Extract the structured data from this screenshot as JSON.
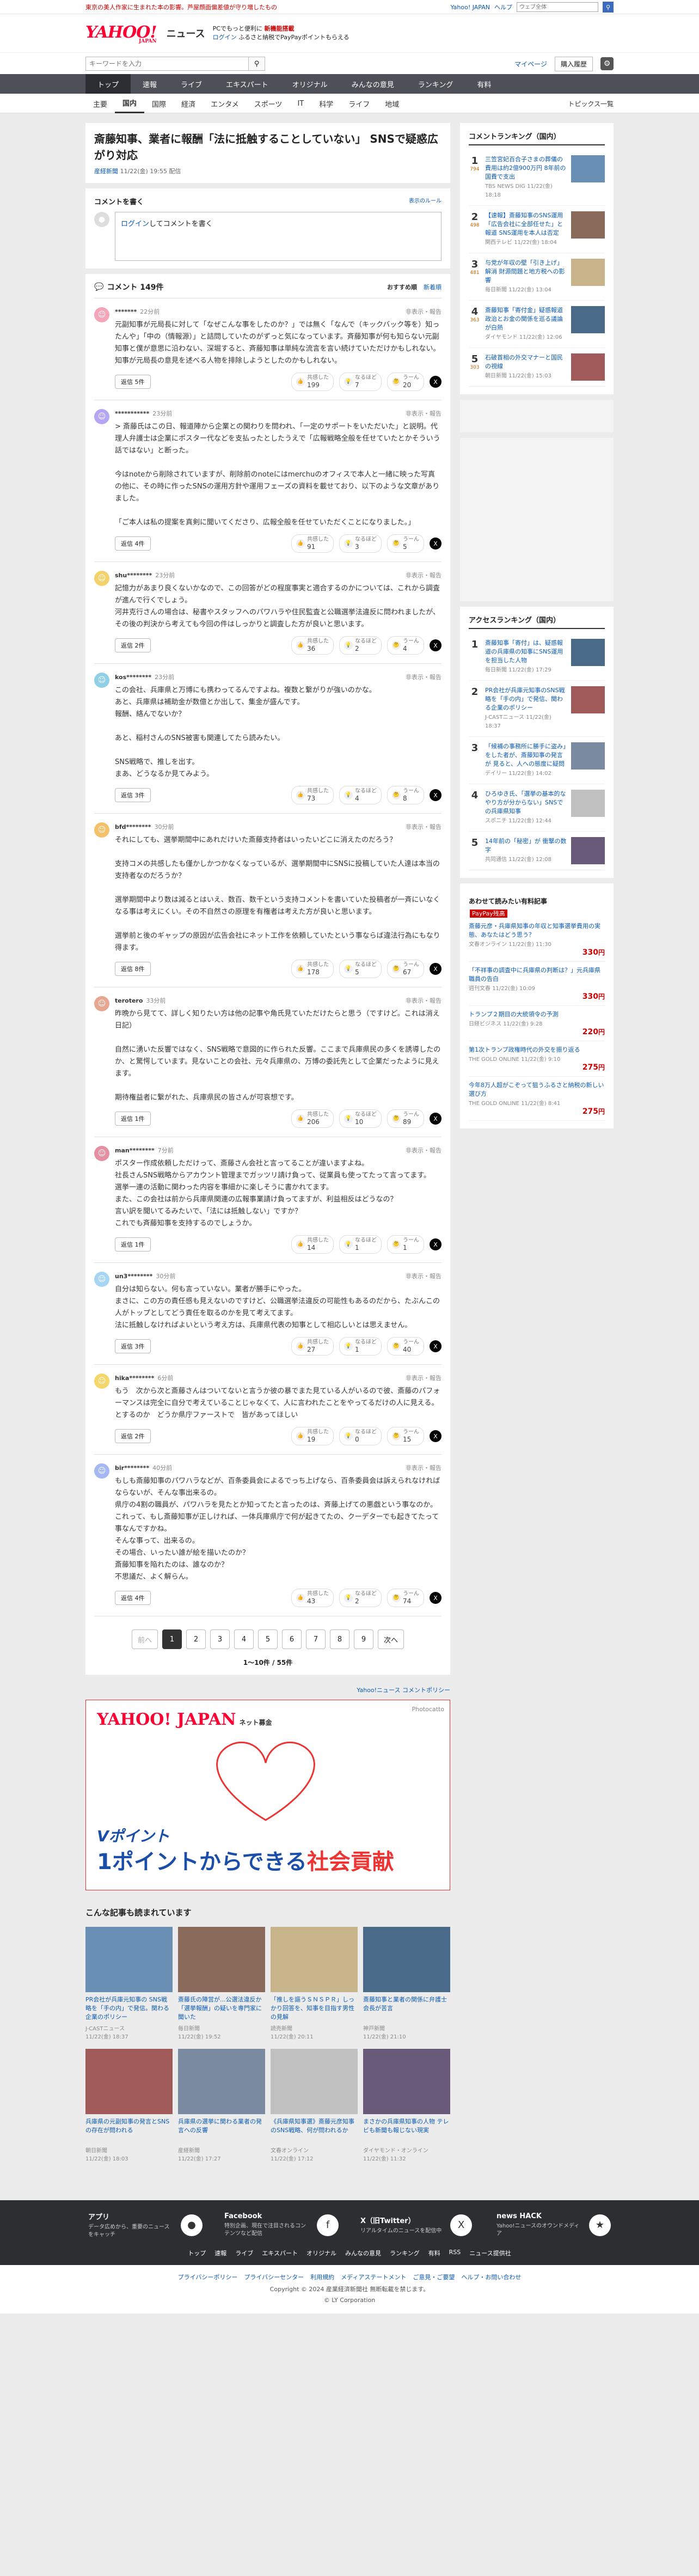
{
  "top_strip": {
    "notice": "東京の美人作家に生まれた本の影響。芦屋顔面偏差値が守り増したもの",
    "links": [
      "Yahoo! JAPAN",
      "ヘルプ"
    ],
    "search_placeholder": "ウェブ全体"
  },
  "header": {
    "logo": "YAHOO!",
    "logo_sub": "JAPAN",
    "service": "ニュース",
    "promo_line1_a": "PCでもっと便利に",
    "promo_line1_b": "新機能搭載",
    "promo_line2_a": "ログイン",
    "promo_line2_b": "ふるさと納税でPayPayポイントもらえる"
  },
  "search": {
    "placeholder": "キーワードを入力",
    "mypage": "マイページ",
    "register": "購入履歴"
  },
  "main_nav": [
    "トップ",
    "速報",
    "ライブ",
    "エキスパート",
    "オリジナル",
    "みんなの意見",
    "ランキング",
    "有料"
  ],
  "sub_nav": {
    "cats": [
      "主要",
      "国内",
      "国際",
      "経済",
      "エンタメ",
      "スポーツ",
      "IT",
      "科学",
      "ライフ",
      "地域"
    ],
    "topics": "トピックス一覧"
  },
  "article": {
    "title": "斎藤知事、業者に報酬「法に抵触することしていない」 SNSで疑惑広がり対応",
    "source": "産経新聞",
    "date": "11/22(金) 19:55 配信"
  },
  "comment_write": {
    "heading": "コメントを書く",
    "policy": "表示のルール",
    "login": "ログイン",
    "placeholder": "してコメントを書く"
  },
  "comments_head": {
    "count": "コメント 149件",
    "sort_recommended": "おすすめ順",
    "sort_new": "新着順"
  },
  "vote_labels": {
    "a": "共感した",
    "b": "なるほど",
    "c": "うーん"
  },
  "common": {
    "reply": "返信",
    "report": "非表示・報告"
  },
  "comments": [
    {
      "user": "*******",
      "time": "22分前",
      "text": "元副知事が元局長に対して「なぜこんな事をしたのか？」では無く「なんで（キックバック等を）知ったんや」「中の（情報源）」と詰問していたのがずっと気になっています。斉藤知事が何も知らない元副知事と僕が意思に沿わない、深堀すると、斉藤知事は単純な流言を言い続けていただけかもしれない。\n知事が元局長の意見を述べる人物を排除しようとしたのかもしれない。",
      "replies": "返信 5件",
      "v1": "199",
      "v2": "7",
      "v3": "20"
    },
    {
      "user": "***********",
      "time": "23分前",
      "text": "> 斎藤氏はこの日、報道陣から企業との関わりを問われ、「一定のサポートをいただいた」と説明。代理人弁護士は企業にポスター代などを支払ったとしたうえで「広報戦略全般を任せていたとかそういう話ではない」と断った。\n\n今はnoteから削除されていますが、削除前のnoteにはmerchuのオフィスで本人と一緒に映った写真の他に、その時に作ったSNSの運用方針や運用フェーズの資料を載せており、以下のような文章がありました。\n\n「ご本人は私の提案を真剣に聞いてくださり、広報全般を任せていただくことになりました。」",
      "replies": "返信 4件",
      "v1": "91",
      "v2": "3",
      "v3": "5"
    },
    {
      "user": "shu********",
      "time": "23分前",
      "text": "記憶力があまり良くないかなので、この回答がどの程度事実と適合するのかについては、これから調査が進んで行くでしょう。\n河井克行さんの場合は、秘書やスタッフへのパワハラや住民監査と公職選挙法違反に問われましたが、その後の判決から考えても今回の件はしっかりと調査した方が良いと思います。",
      "replies": "返信 2件",
      "v1": "36",
      "v2": "2",
      "v3": "4"
    },
    {
      "user": "kos********",
      "time": "23分前",
      "text": "この会社、兵庫県と万博にも携わってるんですよね。複数と繋がりが強いのかな。\nあと、兵庫県は補助金が数億とか出して、集金が盛んです。\n報酬、絡んでないか？\n\nあと、稲村さんのSNS被害も関連してたら読みたい。\n\nSNS戦略で、推しを出す。\nまあ、どうなるか見てみよう。",
      "replies": "返信 3件",
      "v1": "73",
      "v2": "4",
      "v3": "8"
    },
    {
      "user": "bfd********",
      "time": "30分前",
      "text": "それにしても、選挙期間中にあれだけいた斎藤支持者はいったいどこに消えたのだろう？\n\n支持コメの共感したも僅かしかつかなくなっているが、選挙期間中にSNSに投稿していた人達は本当の支持者なのだろうか？\n\n選挙期間中より数は減るとはいえ、数百、数千という支持コメントを書いていた投稿者が一斉にいなくなる事は考えにくい。その不自然さの原理を有権者は考えた方が良いと思います。\n\n選挙前と後のギャップの原因が広告会社にネット工作を依頼していたという事ならば違法行為にもなり得ます。",
      "replies": "返信 8件",
      "v1": "178",
      "v2": "5",
      "v3": "67"
    },
    {
      "user": "terotero",
      "time": "33分前",
      "text": "昨晩から見てて、詳しく知りたい方は他の記事や角氏見ていただけたらと思う（ですけど。これは消え日記）\n\n自然に湧いた反響ではなく、SNS戦略で意図的に作られた反響。ここまで兵庫県民の多くを誘導したのか、と驚愕しています。見ないことの会社、元々兵庫県の、万博の委託先として企業だったように見えます。\n\n期待権益者に繋がれた、兵庫県民の皆さんが可哀想です。",
      "replies": "返信 1件",
      "v1": "206",
      "v2": "10",
      "v3": "89"
    },
    {
      "user": "man********",
      "time": "7分前",
      "text": "ポスター作成依頼しただけって、斎藤さん会社と言ってることが違いますよね。\n社長さんSNS戦略からアカウント管理までガッツリ請け負って、従業員も使ってたって言ってます。\n選挙一連の活動に関わった内容を事細かに楽しそうに書かれてます。\nまた、この会社は前から兵庫県関連の広報事業請け負ってますが、利益相反はどうなの？\n言い訳を聞いてるみたいで、「法には抵触しない」ですか？\nこれでも斉藤知事を支持するのでしょうか。",
      "replies": "返信 1件",
      "v1": "14",
      "v2": "1",
      "v3": "1"
    },
    {
      "user": "un3********",
      "time": "30分前",
      "text": "自分は知らない。何も言っていない。業者が勝手にやった。\nまさに、この方の責任感も見えないのですけど、公職選挙法違反の可能性もあるのだから、たぶんこの人がトップとしてどう責任を取るのかを見て考えてます。\n法に抵触しなければよいという考え方は、兵庫県代表の知事として相応しいとは思えません。",
      "replies": "返信 3件",
      "v1": "27",
      "v2": "1",
      "v3": "40"
    },
    {
      "user": "hika********",
      "time": "6分前",
      "text": "もう　次から次と斎藤さんはついてないと言うか彼の暴でまた見ている人がいるので彼、斎藤のパフォーマンスは完全に自分で考えていることじゃなくて、人に言われたことをやってるだけの人に見える。\nとするのか　どうか県庁ファーストで　皆があってほしい",
      "replies": "返信 2件",
      "v1": "19",
      "v2": "0",
      "v3": "15"
    },
    {
      "user": "bir********",
      "time": "40分前",
      "text": "もしも斎藤知事のパワハラなどが、百条委員会によるでっち上げなら、百条委員会は訴えられなければならないが、そんな事出来るの。\n県庁の4割の職員が、パワハラを見たとか知ってたと言ったのは、斉藤上げての悪戯という事なのか。\nこれって、もし斎藤知事が正しければ、一体兵庫県庁で何が起きてたの、クーデターでも起きてたって事なんですかね。\nそんな事って、出来るの。\nその場合、いったい誰が絵を描いたのか？\n斎藤知事を陥れたのは、誰なのか？\n不思議だ、よく解らん。",
      "replies": "返信 4件",
      "v1": "43",
      "v2": "2",
      "v3": "74"
    }
  ],
  "pager": {
    "prev": "前へ",
    "pages": [
      "1",
      "2",
      "3",
      "4",
      "5",
      "6",
      "7",
      "8",
      "9"
    ],
    "next": "次へ",
    "info": "1〜10件 / 55件"
  },
  "guideline": "Yahoo!ニュース コメントポリシー",
  "ad": {
    "logo": "YAHOO! JAPAN",
    "logo_sub": "ネット募金",
    "photo": "Photocatto",
    "line1": "Vポイント",
    "line2a": "1ポイントからできる",
    "line2b": "社会貢献"
  },
  "recs": {
    "title": "こんな記事も読まれています",
    "items": [
      {
        "title": "PR会社が兵庫元知事の SNS戦略を「手の内」で発信。関わる企業のポリシー",
        "src": "J-CASTニュース",
        "time": "11/22(金) 18:37"
      },
      {
        "title": "斎藤氏の陣営が...公選法違反か「選挙報酬」の疑いを専門家に聞いた",
        "src": "毎日新聞",
        "time": "11/22(金) 19:52"
      },
      {
        "title": "「推しを謳うＳＮＳＰＲ」しっかり回答を、知事を目指す男性の見解",
        "src": "読売新聞",
        "time": "11/22(金) 20:11"
      },
      {
        "title": "斎藤知事と業者の関係に弁護士会長が苦言",
        "src": "神戸新聞",
        "time": "11/22(金) 21:10"
      },
      {
        "title": "兵庫県の元副知事の発言とSNSの存在が問われる",
        "src": "朝日新聞",
        "time": "11/22(金) 18:03"
      },
      {
        "title": "兵庫県の選挙に関わる業者の発言への反響",
        "src": "産経新聞",
        "time": "11/22(金) 17:27"
      },
      {
        "title": "《兵庫県知事選》斎藤元彦知事のSNS戦略、何が問われるか",
        "src": "文春オンライン",
        "time": "11/22(金) 17:12"
      },
      {
        "title": "まさかの兵庫県知事の人物 テレビも新聞も報じない現実",
        "src": "ダイヤモンド・オンライン",
        "time": "11/22(金) 11:32"
      }
    ]
  },
  "side_rank": {
    "title": "コメントランキング（国内）",
    "items": [
      {
        "no": "1",
        "cnt": "794",
        "title": "三笠宮妃百合子さまの葬儀の費用は約2億900万円 8年前の国費で支出",
        "src": "TBS NEWS DIG",
        "time": "11/22(金) 18:18"
      },
      {
        "no": "2",
        "cnt": "498",
        "title": "【速報】斎藤知事のSNS運用「広告会社に全部任せた」と報道 SNS運用を本人は否定",
        "src": "関西テレビ",
        "time": "11/22(金) 18:04"
      },
      {
        "no": "3",
        "cnt": "481",
        "title": "与党が年収の壁「引き上げ」解消 財源問題と地方税への影響",
        "src": "毎日新聞",
        "time": "11/22(金) 13:04"
      },
      {
        "no": "4",
        "cnt": "363",
        "title": "斎藤知事「寄付金」疑惑報道 政治とお金の関係を巡る議論が白熱",
        "src": "ダイヤモンド",
        "time": "11/22(金) 12:06"
      },
      {
        "no": "5",
        "cnt": "303",
        "title": "石破首相の外交マナーと国民の視線",
        "src": "朝日新聞",
        "time": "11/22(金) 15:03"
      }
    ]
  },
  "side_access": {
    "title": "アクセスランキング（国内）",
    "items": [
      {
        "no": "1",
        "title": "斎藤知事「寄付」は、疑惑報道の兵庫県の知事にSNS運用を担当した人物",
        "src": "毎日新聞",
        "time": "11/22(金) 17:29"
      },
      {
        "no": "2",
        "title": "PR会社が兵庫元知事のSNS戦略を「手の内」で発信、関わる企業のポリシー",
        "src": "J-CASTニュース",
        "time": "11/22(金) 18:37"
      },
      {
        "no": "3",
        "title": "「候補の事務所に勝手に盗み」をした者が、斎藤知事の発言が 見ると、人への態度に疑問",
        "src": "デイリー",
        "time": "11/22(金) 14:02"
      },
      {
        "no": "4",
        "title": "ひろゆき氏、「選挙の基本的なやり方が分からない」SNSでの兵庫県知事",
        "src": "スポニチ",
        "time": "11/22(金) 12:44"
      },
      {
        "no": "5",
        "title": "14年前の「秘密」が 衝撃の数字",
        "src": "共同通信",
        "time": "11/22(金) 12:08"
      }
    ]
  },
  "side_paypay": {
    "title": "あわせて読みたい有料記事",
    "tag": "PayPay残高",
    "items": [
      {
        "title": "斎藤元彦・兵庫県知事の年収と知事選挙費用の実態、あなたはどう思う？",
        "src": "文春オンライン",
        "time": "11/22(金) 11:30",
        "price": "330"
      },
      {
        "title": "「不祥事の調査中に兵庫県の判断は？」元兵庫県職員の告白",
        "src": "週刊文春",
        "time": "11/22(金) 10:09",
        "price": "330"
      },
      {
        "title": "トランプ２期目の大統領令の予測",
        "src": "日経ビジネス",
        "time": "11/22(金) 9:28",
        "price": "220"
      },
      {
        "title": "第1次トランプ政権時代の外交を振り返る",
        "src": "THE GOLD ONLINE",
        "time": "11/22(金) 9:10",
        "price": "275"
      },
      {
        "title": "今年8万人超がこぞって狙うふるさと納税の新しい選び方",
        "src": "THE GOLD ONLINE",
        "time": "11/22(金) 8:41",
        "price": "275"
      }
    ]
  },
  "footer": {
    "boxes": [
      {
        "title": "アプリ",
        "desc": "データ広めから、重要のニュースをキャッチ"
      },
      {
        "title": "Facebook",
        "desc": "特別企画、現在で注目されるコンテンツなど配信"
      },
      {
        "title": "X（旧Twitter）",
        "desc": "リアルタイムのニュースを配信中"
      },
      {
        "title": "news HACK",
        "desc": "Yahoo!ニュースのオウンドメディア"
      }
    ],
    "nav": [
      "トップ",
      "速報",
      "ライブ",
      "エキスパート",
      "オリジナル",
      "みんなの意見",
      "ランキング",
      "有料",
      "RSS",
      "ニュース提供社"
    ],
    "links": [
      "プライバシーポリシー",
      "プライバシーセンター",
      "利用規約",
      "メディアステートメント",
      "ご意見・ご要望",
      "ヘルプ・お問い合わせ"
    ],
    "copy": "Copyright © 2024 産業経済新聞社 無断転載を禁じます。",
    "copy2": "© LY Corporation"
  }
}
